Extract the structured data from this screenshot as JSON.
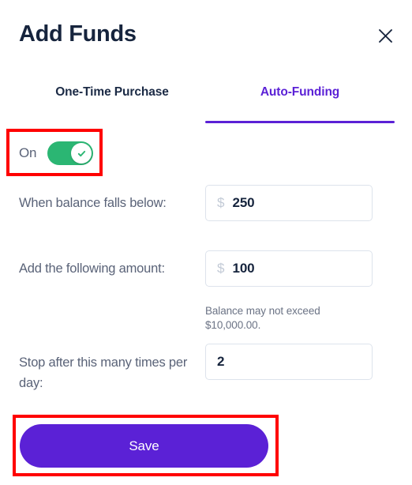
{
  "header": {
    "title": "Add Funds",
    "close_icon": "close-icon"
  },
  "tabs": [
    {
      "label": "One-Time Purchase",
      "active": false
    },
    {
      "label": "Auto-Funding",
      "active": true
    }
  ],
  "toggle": {
    "label": "On",
    "state": "on",
    "icon": "check-icon"
  },
  "fields": [
    {
      "label": "When balance falls below:",
      "prefix": "$",
      "value": "250"
    },
    {
      "label": "Add the following amount:",
      "prefix": "$",
      "value": "100",
      "helper": "Balance may not exceed $10,000.00."
    },
    {
      "label": "Stop after this many times per day:",
      "prefix": "",
      "value": "2"
    }
  ],
  "actions": {
    "save_label": "Save"
  },
  "colors": {
    "accent_purple": "#5b21d6",
    "toggle_green": "#2bb673",
    "highlight_red": "#ff0000",
    "title_navy": "#16243d",
    "label_slate": "#5a6378",
    "input_border": "#dde3ec"
  }
}
